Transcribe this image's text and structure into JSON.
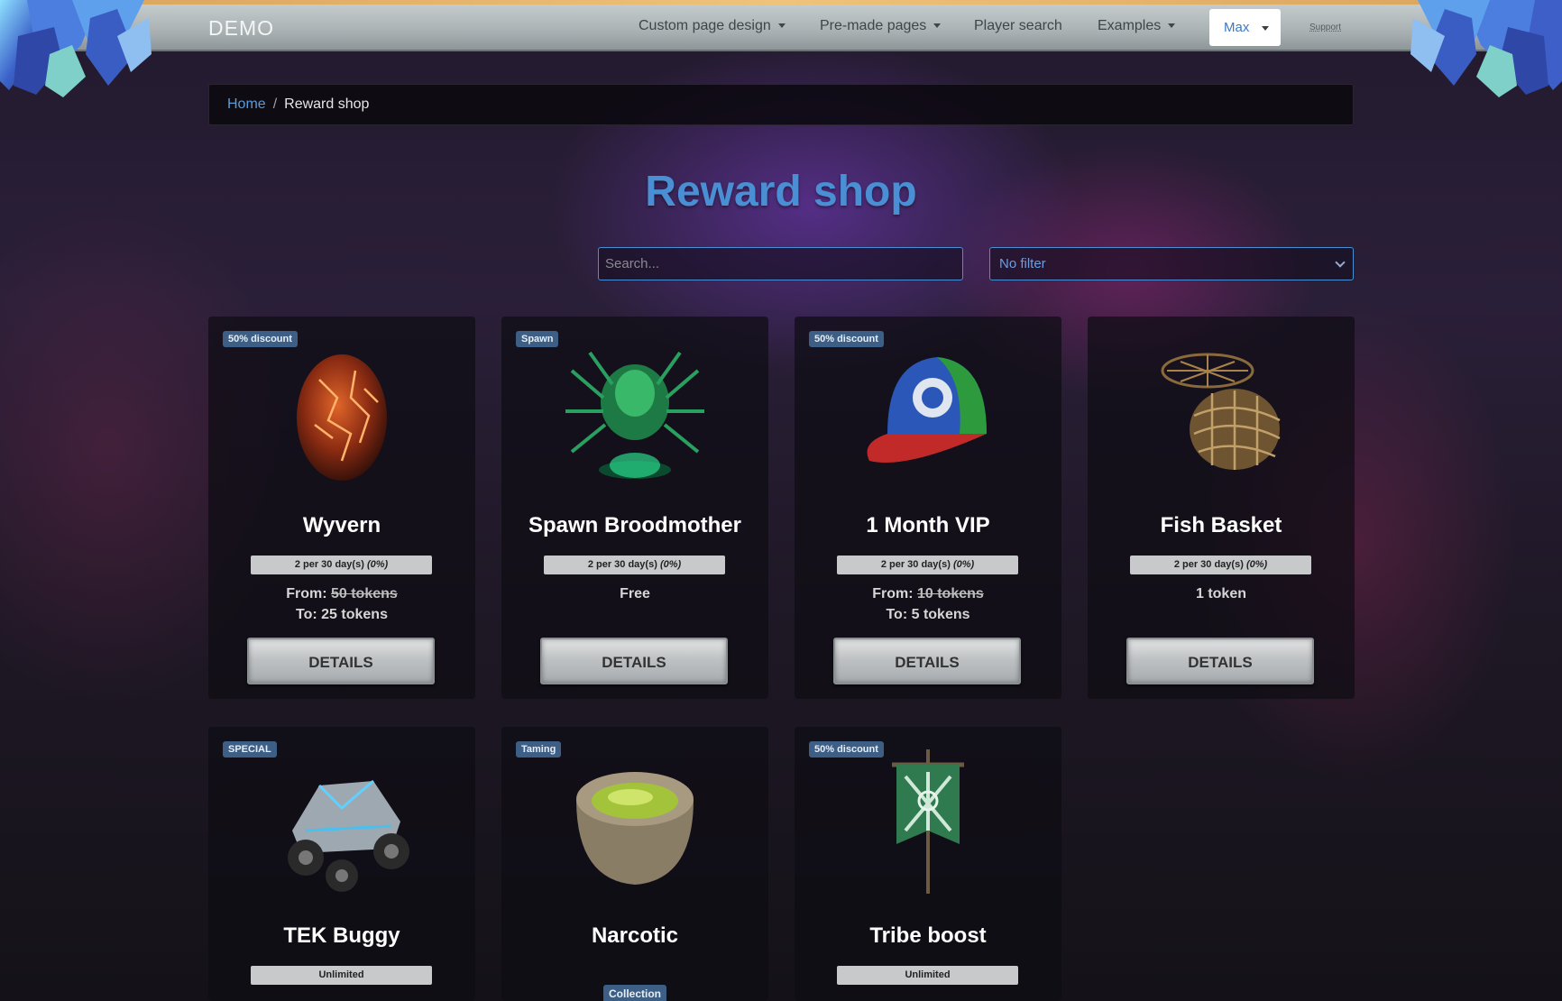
{
  "navbar": {
    "brand": "DEMO",
    "items": [
      {
        "label": "Custom page design",
        "dropdown": true
      },
      {
        "label": "Pre-made pages",
        "dropdown": true
      },
      {
        "label": "Player search",
        "dropdown": false
      },
      {
        "label": "Examples",
        "dropdown": true
      }
    ],
    "user": "Max",
    "support": "Support"
  },
  "breadcrumb": {
    "home": "Home",
    "separator": "/",
    "current": "Reward shop"
  },
  "page_title": "Reward shop",
  "search": {
    "placeholder": "Search...",
    "value": ""
  },
  "filter": {
    "selected": "No filter"
  },
  "cards": [
    {
      "badge": "50% discount",
      "name": "Wyvern",
      "limit": "2 per 30 day(s)",
      "limit_pct": "(0%)",
      "price_from_label": "From:",
      "price_from": "50 tokens",
      "price_to": "To: 25 tokens",
      "button": "DETAILS",
      "icon": "egg-icon"
    },
    {
      "badge": "Spawn",
      "name": "Spawn Broodmother",
      "limit": "2 per 30 day(s)",
      "limit_pct": "(0%)",
      "price": "Free",
      "button": "DETAILS",
      "icon": "spider-icon"
    },
    {
      "badge": "50% discount",
      "name": "1 Month VIP",
      "limit": "2 per 30 day(s)",
      "limit_pct": "(0%)",
      "price_from_label": "From:",
      "price_from": "10 tokens",
      "price_to": "To: 5 tokens",
      "button": "DETAILS",
      "icon": "cap-icon"
    },
    {
      "badge": "",
      "name": "Fish Basket",
      "limit": "2 per 30 day(s)",
      "limit_pct": "(0%)",
      "price": "1 token",
      "button": "DETAILS",
      "icon": "basket-icon"
    },
    {
      "badge": "SPECIAL",
      "name": "TEK Buggy",
      "limit": "Unlimited",
      "icon": "buggy-icon"
    },
    {
      "badge": "Taming",
      "name": "Narcotic",
      "collection": "Collection",
      "icon": "bowl-icon"
    },
    {
      "badge": "50% discount",
      "name": "Tribe boost",
      "limit": "Unlimited",
      "icon": "banner-icon"
    }
  ],
  "colors": {
    "accent": "#4a8fd4",
    "badge": "#3d5f86",
    "navbar": "#a9b1b3"
  }
}
